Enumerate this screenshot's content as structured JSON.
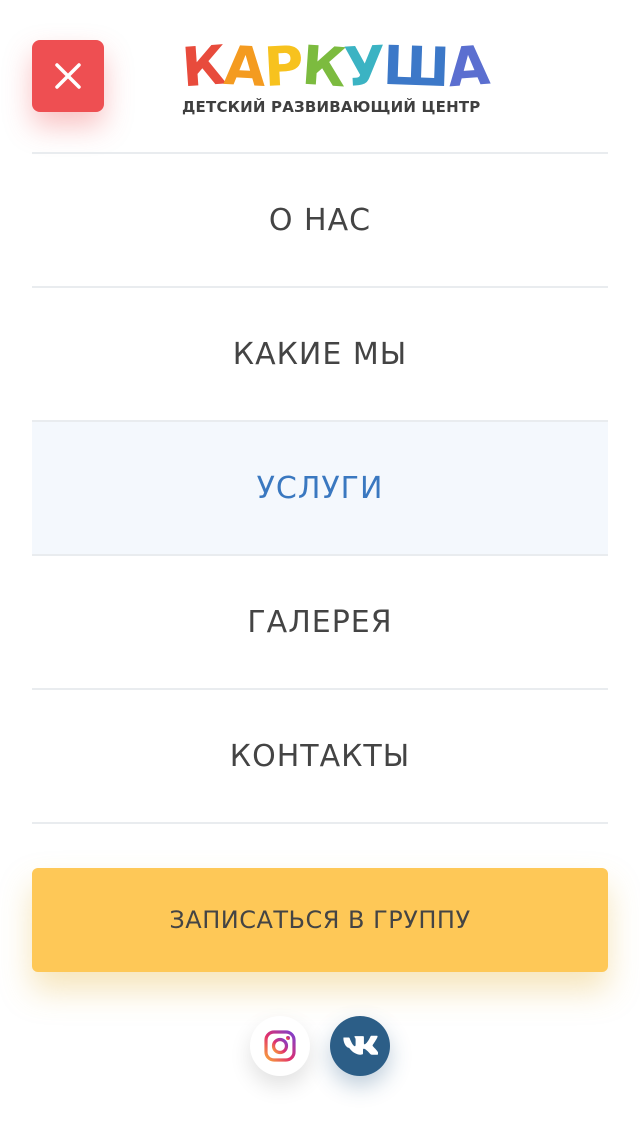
{
  "header": {
    "logo": {
      "letters": [
        {
          "char": "К",
          "color": "#e84b3c"
        },
        {
          "char": "А",
          "color": "#f49b20"
        },
        {
          "char": "Р",
          "color": "#f7c21e"
        },
        {
          "char": "К",
          "color": "#7cbb3f"
        },
        {
          "char": "У",
          "color": "#3bb3c3"
        },
        {
          "char": "Ш",
          "color": "#3c78c8"
        },
        {
          "char": "А",
          "color": "#5b6fd0"
        }
      ],
      "subtitle": "ДЕТСКИЙ РАЗВИВАЮЩИЙ ЦЕНТР"
    },
    "close_icon": "close-icon"
  },
  "menu": {
    "items": [
      {
        "label": "О НАС",
        "active": false
      },
      {
        "label": "КАКИЕ МЫ",
        "active": false
      },
      {
        "label": "УСЛУГИ",
        "active": true
      },
      {
        "label": "ГАЛЕРЕЯ",
        "active": false
      },
      {
        "label": "КОНТАКТЫ",
        "active": false
      }
    ]
  },
  "cta": {
    "label": "ЗАПИСАТЬСЯ В ГРУППУ"
  },
  "socials": {
    "instagram_icon": "instagram-icon",
    "vk_icon": "vk-icon"
  },
  "colors": {
    "close_bg": "#ee4f52",
    "active_bg": "#f4f8fd",
    "active_text": "#3a78c0",
    "cta_bg": "#fec857",
    "vk_bg": "#2c5e87"
  }
}
